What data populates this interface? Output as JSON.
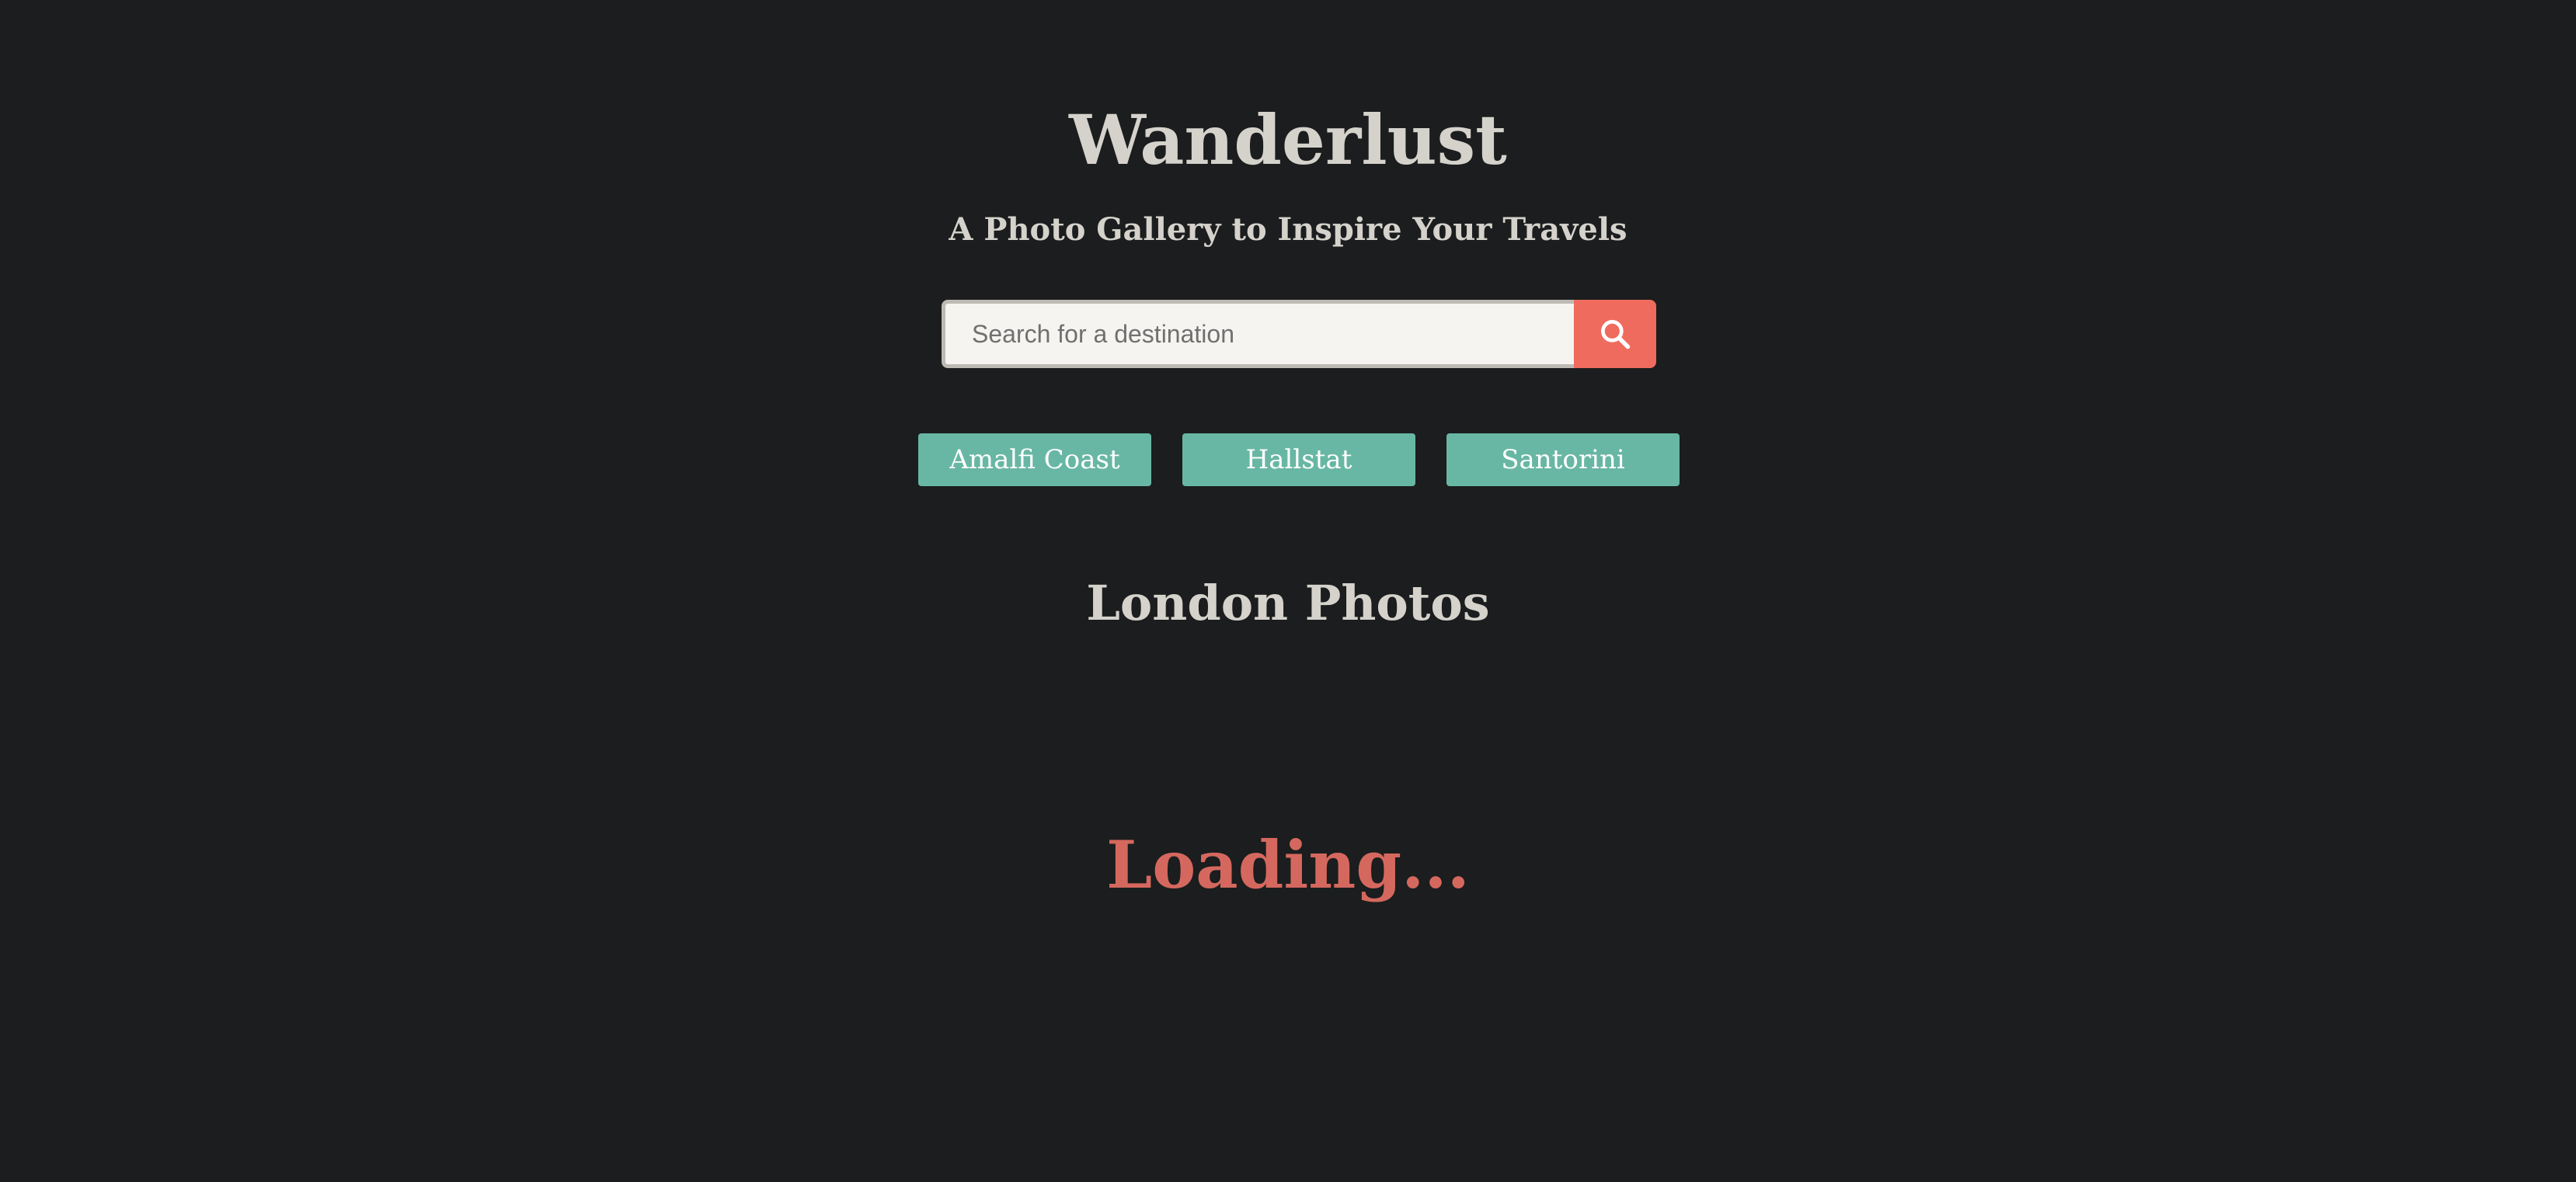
{
  "header": {
    "title": "Wanderlust",
    "subtitle": "A Photo Gallery to Inspire Your Travels"
  },
  "search": {
    "placeholder": "Search for a destination",
    "value": "",
    "button_icon": "search-icon"
  },
  "destinations": [
    {
      "label": "Amalfi Coast"
    },
    {
      "label": "Hallstat"
    },
    {
      "label": "Santorini"
    }
  ],
  "gallery": {
    "title": "London Photos",
    "status": "Loading..."
  },
  "colors": {
    "background": "#1b1d1e",
    "heading_text": "#d5d2cc",
    "accent_search": "#ef6b5d",
    "destination_button": "#68b7a4",
    "loading_text": "#d5685e"
  }
}
